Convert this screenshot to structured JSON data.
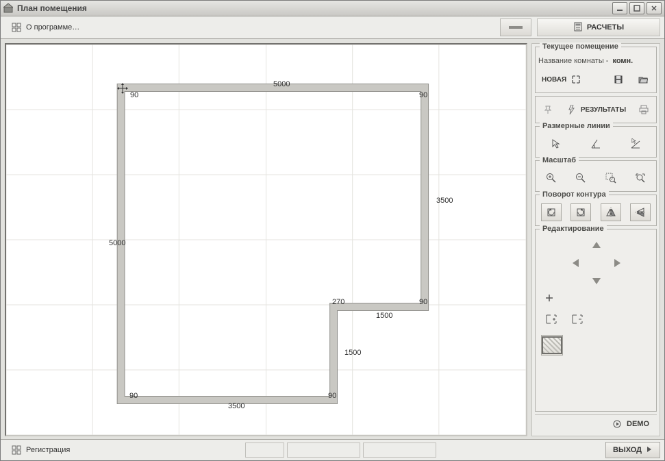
{
  "window": {
    "title": "План помещения"
  },
  "toolbar": {
    "about_label": "О программе…",
    "calc_label": "РАСЧЕТЫ"
  },
  "sidebar": {
    "current_room": {
      "title": "Текущее помещение",
      "name_label": "Название комнаты -",
      "name_value": "комн.",
      "new_label": "НОВАЯ"
    },
    "results_label": "РЕЗУЛЬТАТЫ",
    "dimension_lines_title": "Размерные линии",
    "scale_title": "Масштаб",
    "rotate_title": "Поворот контура",
    "edit_title": "Редактирование",
    "demo_label": "DEMO"
  },
  "statusbar": {
    "registration_label": "Регистрация",
    "exit_label": "ВЫХОД"
  },
  "plan": {
    "dimensions": {
      "top_width": "5000",
      "left_height": "5000",
      "right_height": "3500",
      "notch_width": "1500",
      "notch_height": "1500",
      "bottom_width": "3500",
      "notch_angle": "270"
    },
    "angles": {
      "tl": "90",
      "tr": "90",
      "notch_tr": "90",
      "notch_bl": "90",
      "bl": "90",
      "br": "90"
    }
  }
}
